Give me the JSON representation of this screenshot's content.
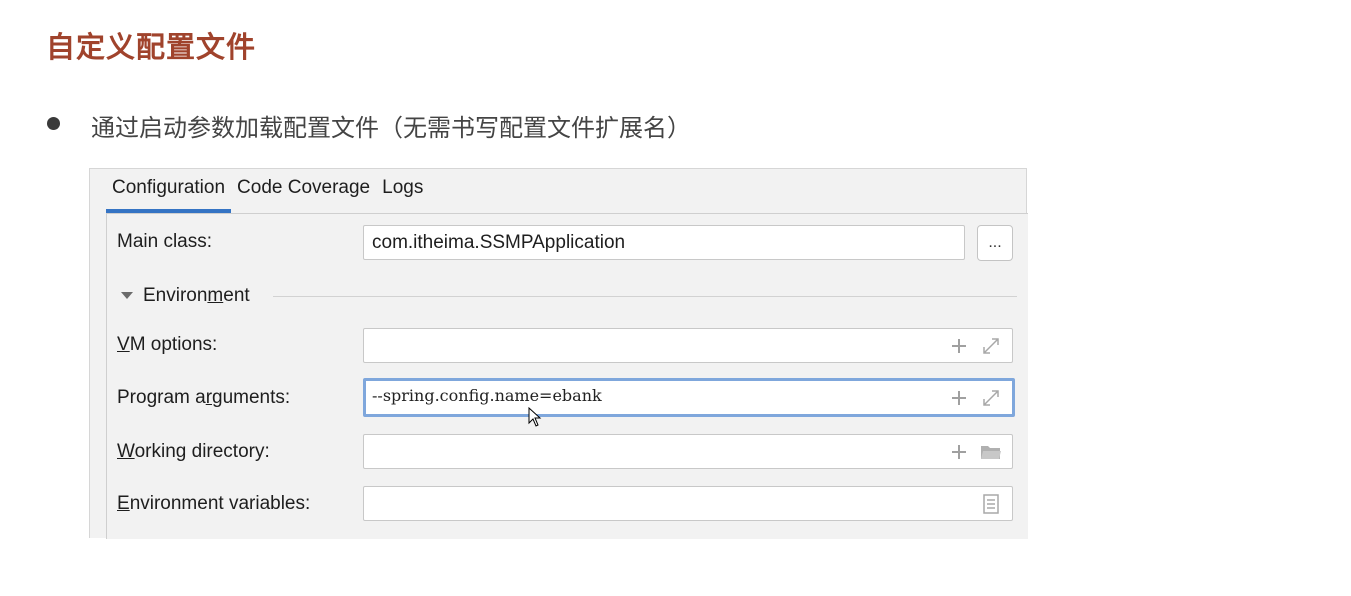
{
  "slide": {
    "title": "自定义配置文件",
    "bullet": "通过启动参数加载配置文件（无需书写配置文件扩展名）"
  },
  "tabs": [
    {
      "label": "Configuration",
      "active": true
    },
    {
      "label": "Code Coverage",
      "active": false
    },
    {
      "label": "Logs",
      "active": false
    }
  ],
  "main_class": {
    "label": "Main class:",
    "value": "com.itheima.SSMPApplication",
    "browse_label": "..."
  },
  "environment": {
    "label_before": "Environ",
    "label_mnemonic": "m",
    "label_after": "ent"
  },
  "vm_options": {
    "label_mnemonic": "V",
    "label_rest": "M options:",
    "value": ""
  },
  "program_arguments": {
    "label_before": "Program a",
    "label_mnemonic": "r",
    "label_after": "guments:",
    "value": "--spring.config.name=ebank"
  },
  "working_directory": {
    "label_mnemonic": "W",
    "label_rest": "orking directory:",
    "value": ""
  },
  "environment_variables": {
    "label_mnemonic": "E",
    "label_rest": "nvironment variables:",
    "value": ""
  },
  "colors": {
    "title": "#a0432c",
    "tab_underline": "#3574c4",
    "focus_border": "#7fa7dc",
    "panel_bg": "#f2f2f2"
  },
  "icons": [
    "plus-icon",
    "expand-icon",
    "folder-icon",
    "document-icon",
    "triangle-down-icon",
    "mouse-cursor-icon"
  ]
}
